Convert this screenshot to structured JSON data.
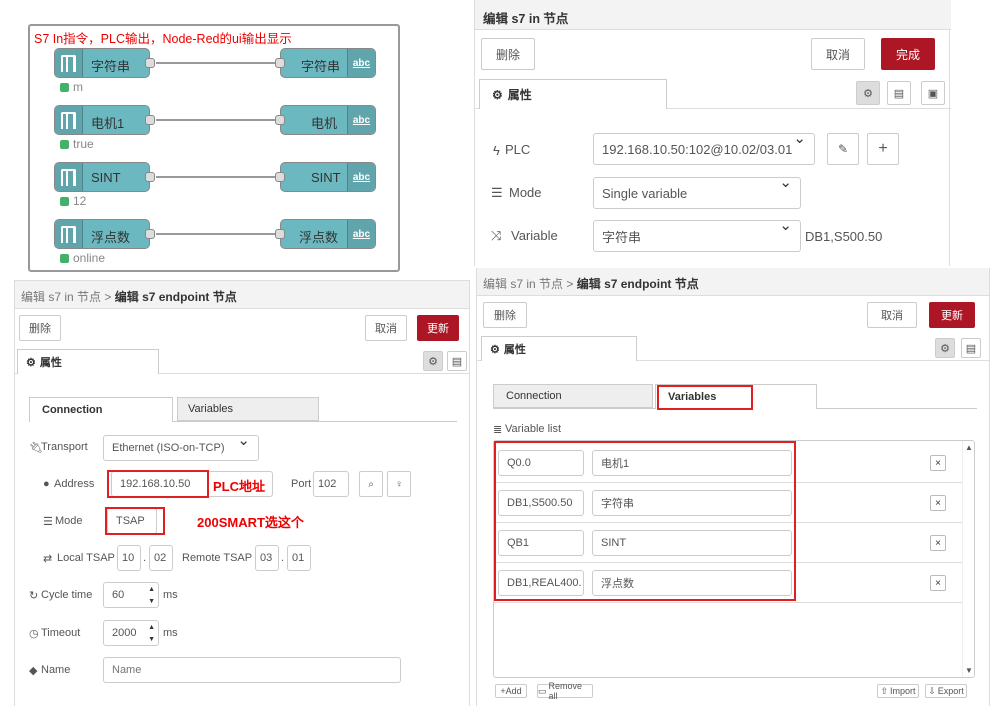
{
  "flow": {
    "title": "S7 In指令，PLC输出，Node-Red的ui输出显示",
    "rows": [
      {
        "in_label": "字符串",
        "out_label": "字符串",
        "status": "m"
      },
      {
        "in_label": "电机1",
        "out_label": "电机",
        "status": "true"
      },
      {
        "in_label": "SINT",
        "out_label": "SINT",
        "status": "12"
      },
      {
        "in_label": "浮点数",
        "out_label": "浮点数",
        "status": "online"
      }
    ],
    "text_icon": "abc"
  },
  "s7in": {
    "title": "编辑 s7 in 节点",
    "delete_label": "删除",
    "cancel_label": "取消",
    "done_label": "完成",
    "props_tab": "属性",
    "plc_label": "PLC",
    "plc_value": "192.168.10.50:102@10.02/03.01",
    "mode_label": "Mode",
    "mode_value": "Single variable",
    "variable_label": "Variable",
    "variable_value": "字符串",
    "variable_address": "DB1,S500.50"
  },
  "endpoint": {
    "breadcrumb_parent": "编辑 s7 in 节点",
    "breadcrumb_sep": ">",
    "breadcrumb_current": "编辑 s7 endpoint 节点",
    "delete_label": "删除",
    "cancel_label": "取消",
    "update_label": "更新",
    "props_tab": "属性",
    "tab_connection": "Connection",
    "tab_variables": "Variables",
    "transport_label": "Transport",
    "transport_value": "Ethernet (ISO-on-TCP)",
    "address_label": "Address",
    "address_value": "192.168.10.50",
    "address_annotation": "PLC地址",
    "port_label": "Port",
    "port_value": "102",
    "mode_label": "Mode",
    "mode_value": "TSAP",
    "mode_annotation": "200SMART选这个",
    "local_tsap_label": "Local TSAP",
    "local_tsap_1": "10",
    "local_tsap_2": "02",
    "tsap_dot": ".",
    "remote_tsap_label": "Remote TSAP",
    "remote_tsap_1": "03",
    "remote_tsap_2": "01",
    "cycle_label": "Cycle time",
    "cycle_value": "60",
    "timeout_label": "Timeout",
    "timeout_value": "2000",
    "unit_ms": "ms",
    "name_label": "Name",
    "name_placeholder": "Name"
  },
  "endpoint2": {
    "breadcrumb_parent": "编辑 s7 in 节点",
    "breadcrumb_sep": ">",
    "breadcrumb_current": "编辑 s7 endpoint 节点",
    "delete_label": "删除",
    "cancel_label": "取消",
    "update_label": "更新",
    "props_tab": "属性",
    "tab_connection": "Connection",
    "tab_variables": "Variables",
    "list_label": "Variable list",
    "variables": [
      {
        "address": "Q0.0",
        "name": "电机1"
      },
      {
        "address": "DB1,S500.50",
        "name": "字符串"
      },
      {
        "address": "QB1",
        "name": "SINT"
      },
      {
        "address": "DB1,REAL400.",
        "name": "浮点数"
      }
    ],
    "add_label": "+Add",
    "remove_all_label": "Remove all",
    "import_label": "Import",
    "export_label": "Export",
    "remove_glyph": "×"
  },
  "colors": {
    "node_teal": "#6cb8c0",
    "accent_red": "#ad1625",
    "annotation_red": "#e02020",
    "status_green": "#44b068"
  }
}
